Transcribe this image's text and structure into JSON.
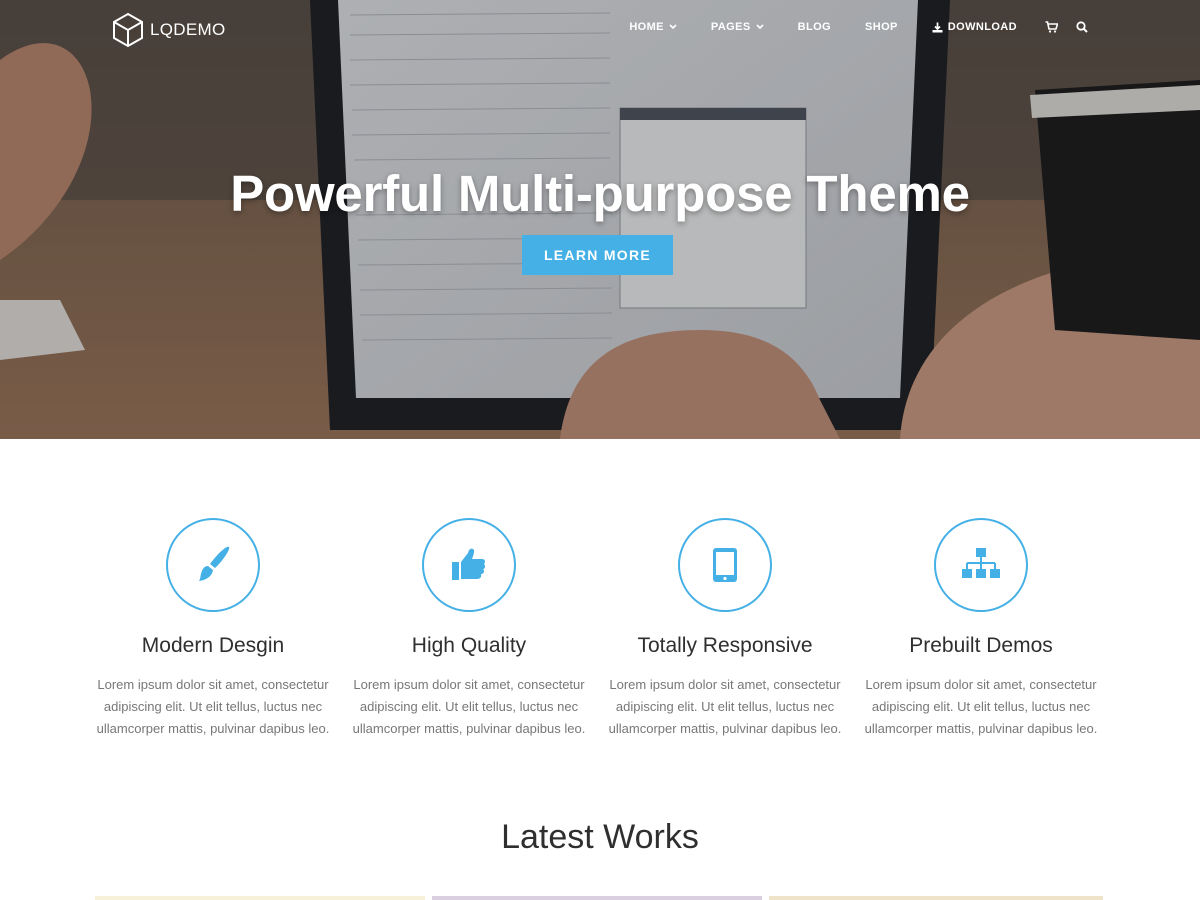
{
  "brand": {
    "name": "LQDEMO"
  },
  "nav": {
    "items": [
      {
        "label": "HOME",
        "has_dropdown": true
      },
      {
        "label": "PAGES",
        "has_dropdown": true
      },
      {
        "label": "BLOG",
        "has_dropdown": false
      },
      {
        "label": "SHOP",
        "has_dropdown": false
      },
      {
        "label": "DOWNLOAD",
        "icon": "download-icon"
      }
    ],
    "icons": [
      "cart-icon",
      "search-icon"
    ]
  },
  "hero": {
    "title": "Powerful Multi-purpose Theme",
    "button_label": "LEARN MORE"
  },
  "features": [
    {
      "icon": "paintbrush-icon",
      "title": "Modern Desgin",
      "text": "Lorem ipsum dolor sit amet, consectetur adipiscing elit. Ut elit tellus, luctus nec ullamcorper mattis, pulvinar dapibus leo."
    },
    {
      "icon": "thumbs-up-icon",
      "title": "High Quality",
      "text": "Lorem ipsum dolor sit amet, consectetur adipiscing elit. Ut elit tellus, luctus nec ullamcorper mattis, pulvinar dapibus leo."
    },
    {
      "icon": "tablet-icon",
      "title": "Totally Responsive",
      "text": "Lorem ipsum dolor sit amet, consectetur adipiscing elit. Ut elit tellus, luctus nec ullamcorper mattis, pulvinar dapibus leo."
    },
    {
      "icon": "sitemap-icon",
      "title": "Prebuilt Demos",
      "text": "Lorem ipsum dolor sit amet, consectetur adipiscing elit. Ut elit tellus, luctus nec ullamcorper mattis, pulvinar dapibus leo."
    }
  ],
  "works": {
    "title": "Latest Works"
  },
  "colors": {
    "accent": "#45b0e5",
    "heading": "#2f2f2f",
    "body_text": "#777777"
  }
}
